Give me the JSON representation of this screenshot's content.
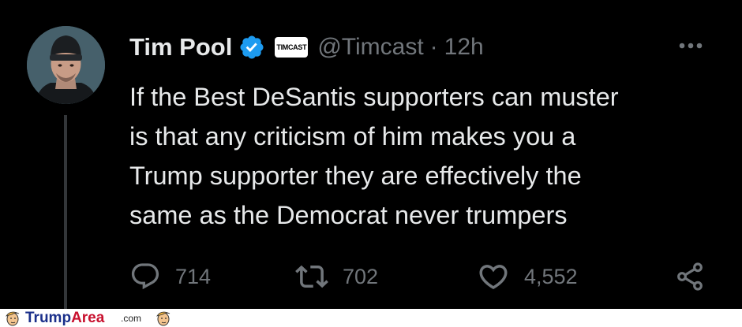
{
  "tweet": {
    "author_name": "Tim Pool",
    "affiliate_badge": "TIMCAST",
    "handle": "@Timcast",
    "separator": "·",
    "time": "12h",
    "text": "If the Best DeSantis supporters can muster\nis that any criticism of him makes you a\nTrump supporter they are effectively the\nsame as the Democrat never trumpers",
    "replies": "714",
    "reposts": "702",
    "likes": "4,552",
    "icons": [
      "verified-badge-icon",
      "more-options-icon",
      "reply-icon",
      "repost-icon",
      "like-icon",
      "share-icon"
    ],
    "colors": {
      "background": "#000000",
      "text": "#e7e9ea",
      "muted": "#71767b",
      "verified": "#1d9bf0"
    }
  },
  "watermark": {
    "brand_part1": "Trump",
    "brand_part2": "Area",
    "tld": ".com",
    "colors": {
      "part1": "#1a2f8a",
      "part2": "#c8102e"
    }
  }
}
